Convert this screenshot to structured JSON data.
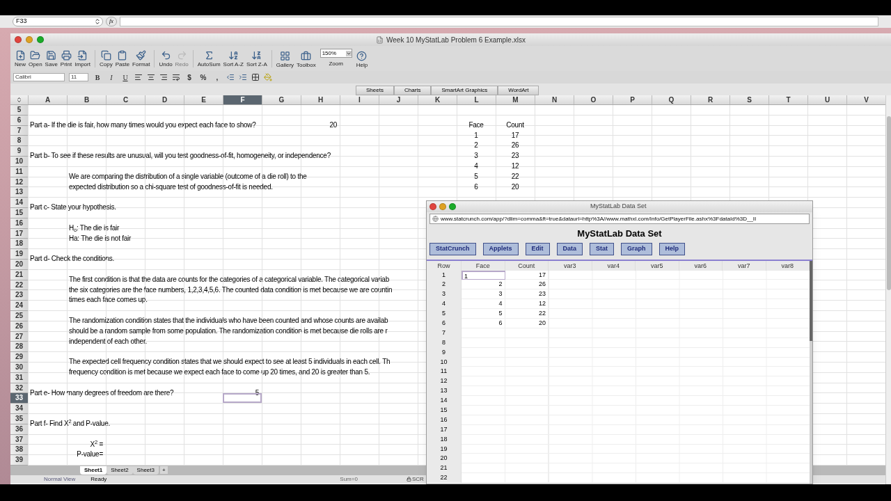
{
  "formula_bar": {
    "name_box": "F33",
    "function_button": "fx"
  },
  "window": {
    "title": "Week 10 MyStatLab Problem 6 Example.xlsx"
  },
  "toolbar": {
    "groups": [
      [
        {
          "kind": "button",
          "label": "New",
          "disabled": false
        },
        {
          "kind": "button",
          "label": "Open",
          "disabled": false
        },
        {
          "kind": "button",
          "label": "Save",
          "disabled": false
        },
        {
          "kind": "button",
          "label": "Print",
          "disabled": false
        },
        {
          "kind": "button",
          "label": "Import",
          "disabled": false
        }
      ],
      [
        {
          "kind": "button",
          "label": "Copy",
          "disabled": false
        },
        {
          "kind": "button",
          "label": "Paste",
          "disabled": false
        },
        {
          "kind": "button",
          "label": "Format",
          "disabled": false
        }
      ],
      [
        {
          "kind": "button",
          "label": "Undo",
          "disabled": false
        },
        {
          "kind": "button",
          "label": "Redo",
          "disabled": true
        }
      ],
      [
        {
          "kind": "button",
          "label": "AutoSum",
          "disabled": false
        },
        {
          "kind": "button",
          "label": "Sort A-Z",
          "disabled": false
        },
        {
          "kind": "button",
          "label": "Sort Z-A",
          "disabled": false
        }
      ],
      [
        {
          "kind": "button",
          "label": "Gallery",
          "disabled": false
        },
        {
          "kind": "button",
          "label": "Toolbox",
          "disabled": false
        },
        {
          "kind": "zoom",
          "label": "Zoom",
          "value": "150%"
        },
        {
          "kind": "button",
          "label": "Help",
          "disabled": false
        }
      ]
    ]
  },
  "format_bar": {
    "font": "Calibri",
    "size": "11",
    "styles": [
      "B",
      "I",
      "U"
    ],
    "number_formats": [
      "$",
      "%",
      ","
    ]
  },
  "ribbon_tabs": [
    "Sheets",
    "Charts",
    "SmartArt Graphics",
    "WordArt"
  ],
  "columns": [
    {
      "label": "A",
      "selected": false
    },
    {
      "label": "B",
      "selected": false
    },
    {
      "label": "C",
      "selected": false
    },
    {
      "label": "D",
      "selected": false
    },
    {
      "label": "E",
      "selected": false
    },
    {
      "label": "F",
      "selected": true
    },
    {
      "label": "G",
      "selected": false
    },
    {
      "label": "H",
      "selected": false
    },
    {
      "label": "I",
      "selected": false
    },
    {
      "label": "J",
      "selected": false
    },
    {
      "label": "K",
      "selected": false
    },
    {
      "label": "L",
      "selected": false
    },
    {
      "label": "M",
      "selected": false
    },
    {
      "label": "N",
      "selected": false
    },
    {
      "label": "O",
      "selected": false
    },
    {
      "label": "P",
      "selected": false
    },
    {
      "label": "Q",
      "selected": false
    },
    {
      "label": "R",
      "selected": false
    },
    {
      "label": "S",
      "selected": false
    },
    {
      "label": "T",
      "selected": false
    },
    {
      "label": "U",
      "selected": false
    },
    {
      "label": "V",
      "selected": false
    }
  ],
  "rows": [
    {
      "number": "5",
      "selected": false,
      "cells": []
    },
    {
      "number": "6",
      "selected": false,
      "cells": [
        "Part a- If the die is fair, how many times would you expect each face to show?",
        "20",
        "Face",
        "Count"
      ]
    },
    {
      "number": "7",
      "selected": false,
      "cells": [
        "1",
        "17"
      ]
    },
    {
      "number": "8",
      "selected": false,
      "cells": [
        "2",
        "26"
      ]
    },
    {
      "number": "9",
      "selected": false,
      "cells": [
        "Part b- To see if these results are unusual, will you test goodness-of-fit, homogeneity, or independence?",
        "3",
        "23"
      ]
    },
    {
      "number": "10",
      "selected": false,
      "cells": [
        "4",
        "12"
      ]
    },
    {
      "number": "11",
      "selected": false,
      "cells": [
        "We are comparing the distribution of a single variable (outcome of a die roll) to the",
        "5",
        "22"
      ]
    },
    {
      "number": "12",
      "selected": false,
      "cells": [
        "expected distribution so a chi-square test of goodness-of-fit is needed.",
        "6",
        "20"
      ]
    },
    {
      "number": "13",
      "selected": false,
      "cells": []
    },
    {
      "number": "14",
      "selected": false,
      "cells": [
        "Part c- State your hypothesis."
      ]
    },
    {
      "number": "15",
      "selected": false,
      "cells": []
    },
    {
      "number": "16",
      "selected": false,
      "cells": [
        "H$_{o}$: The die is fair"
      ]
    },
    {
      "number": "17",
      "selected": false,
      "cells": [
        "Ha: The die is not fair"
      ]
    },
    {
      "number": "18",
      "selected": false,
      "cells": []
    },
    {
      "number": "19",
      "selected": false,
      "cells": [
        "Part d- Check the conditions."
      ]
    },
    {
      "number": "20",
      "selected": false,
      "cells": []
    },
    {
      "number": "21",
      "selected": false,
      "cells": [
        "The first condition is that the data are counts for the categories of a categorical variable. The categorical variab"
      ]
    },
    {
      "number": "22",
      "selected": false,
      "cells": [
        "the six categories are the face numbers, 1,2,3,4,5,6. The counted data condition is met because we are countin"
      ]
    },
    {
      "number": "23",
      "selected": false,
      "cells": [
        "times each face comes up."
      ]
    },
    {
      "number": "24",
      "selected": false,
      "cells": []
    },
    {
      "number": "25",
      "selected": false,
      "cells": [
        "The randomization condition states that the individuals who have been counted and whose counts are availab"
      ]
    },
    {
      "number": "26",
      "selected": false,
      "cells": [
        "should be a random sample from some population. The randomization condition is met because die rolls are r"
      ]
    },
    {
      "number": "27",
      "selected": false,
      "cells": [
        "independent of each other."
      ]
    },
    {
      "number": "28",
      "selected": false,
      "cells": []
    },
    {
      "number": "29",
      "selected": false,
      "cells": [
        "The expected cell frequency condition states that we should expect to see at least 5 individuals in each cell. Th"
      ]
    },
    {
      "number": "30",
      "selected": false,
      "cells": [
        "frequency condition is met because we expect each face to come up 20 times, and 20 is greater than 5."
      ]
    },
    {
      "number": "31",
      "selected": false,
      "cells": []
    },
    {
      "number": "32",
      "selected": false,
      "cells": [
        "Part e- How many degrees of freedom are there?",
        "5"
      ]
    },
    {
      "number": "33",
      "selected": true,
      "cells": []
    },
    {
      "number": "34",
      "selected": false,
      "cells": []
    },
    {
      "number": "35",
      "selected": false,
      "cells": [
        "Part f- Find X$^{2}$ and P-value."
      ]
    },
    {
      "number": "36",
      "selected": false,
      "cells": []
    },
    {
      "number": "37",
      "selected": false,
      "cells": [
        "X$^{2}$ ="
      ]
    },
    {
      "number": "38",
      "selected": false,
      "cells": [
        "P-value="
      ]
    },
    {
      "number": "39",
      "selected": false,
      "cells": []
    }
  ],
  "sheet_tabs": [
    {
      "label": "Sheet1",
      "selected": true
    },
    {
      "label": "Sheet2",
      "selected": false
    },
    {
      "label": "Sheet3",
      "selected": false
    }
  ],
  "add_sheet": "+",
  "status_bar": {
    "view": "Normal View",
    "state": "Ready",
    "sum": "Sum=0",
    "lock": "SCR"
  },
  "data_window": {
    "title": "MyStatLab Data Set",
    "url": "www.statcrunch.com/app/?dlim=comma&ft=true&dataurl=http%3A//www.mathxl.com/Info/GetPlayerFile.ashx%3FdataId%3D__II",
    "heading": "MyStatLab Data Set",
    "menu": [
      "StatCrunch",
      "Applets",
      "Edit",
      "Data",
      "Stat",
      "Graph",
      "Help"
    ],
    "columns": [
      "Row",
      "Face",
      "Count",
      "var3",
      "var4",
      "var5",
      "var6",
      "var7",
      "var8"
    ],
    "rows": [
      {
        "number": "1",
        "face": "1",
        "count": "17",
        "selected": true
      },
      {
        "number": "2",
        "face": "2",
        "count": "26",
        "selected": false
      },
      {
        "number": "3",
        "face": "3",
        "count": "23",
        "selected": false
      },
      {
        "number": "4",
        "face": "4",
        "count": "12",
        "selected": false
      },
      {
        "number": "5",
        "face": "5",
        "count": "22",
        "selected": false
      },
      {
        "number": "6",
        "face": "6",
        "count": "20",
        "selected": false
      },
      {
        "number": "7",
        "selected": false
      },
      {
        "number": "8",
        "selected": false
      },
      {
        "number": "9",
        "selected": false
      },
      {
        "number": "10",
        "selected": false
      },
      {
        "number": "11",
        "selected": false
      },
      {
        "number": "12",
        "selected": false
      },
      {
        "number": "13",
        "selected": false
      },
      {
        "number": "14",
        "selected": false
      },
      {
        "number": "15",
        "selected": false
      },
      {
        "number": "16",
        "selected": false
      },
      {
        "number": "17",
        "selected": false
      },
      {
        "number": "18",
        "selected": false
      },
      {
        "number": "19",
        "selected": false
      },
      {
        "number": "20",
        "selected": false
      },
      {
        "number": "21",
        "selected": false
      },
      {
        "number": "22",
        "selected": false
      }
    ]
  }
}
